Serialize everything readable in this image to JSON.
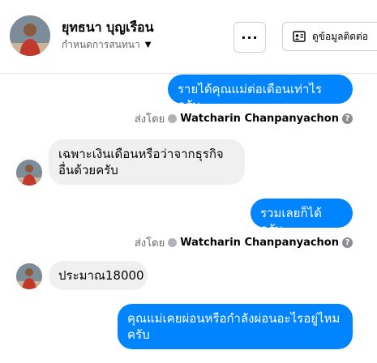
{
  "header": {
    "name": "ยุทธนา บุญเรือน",
    "subtitle": "กำหนดการสนทนา",
    "more_label": "···",
    "profile_label": "ดูข้อมูลติดต่อ"
  },
  "messages": [
    {
      "side": "out",
      "text": "รายได้คุณแม่ต่อเดือนเท่าไรครับ"
    },
    {
      "side": "in",
      "text": "เฉพาะเงินเดือนหรือว่าจากธุรกิจอื่นด้วยครับ"
    },
    {
      "side": "out",
      "text": "รวมเลยก็ได้ครับ"
    },
    {
      "side": "in",
      "text": "ประมาณ18000"
    },
    {
      "side": "out",
      "text": "คุณแม่เคยผ่อนหรือกำลังผ่อนอะไรอยู่ไหมครับ"
    }
  ],
  "sent_by": {
    "prefix": "ส่งโดย",
    "sender": "Watcharin Chanpanyachon",
    "help": "?"
  }
}
